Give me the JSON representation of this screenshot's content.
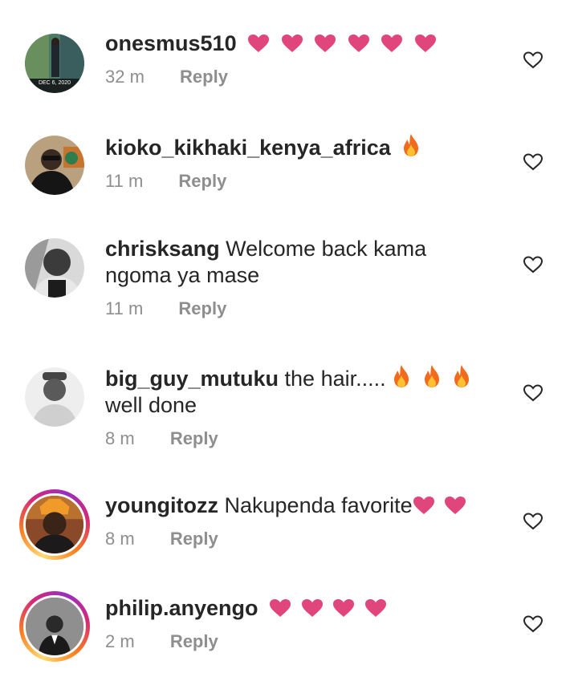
{
  "comments": [
    {
      "username": "onesmus510",
      "text": "",
      "time": "32 m",
      "reply": "Reply",
      "emoji": "heart",
      "emoji_count": 6,
      "avatar_caption": "DEC 6, 2020"
    },
    {
      "username": "kioko_kikhaki_kenya_africa",
      "text": "",
      "time": "11 m",
      "reply": "Reply",
      "emoji": "fire",
      "emoji_count": 1
    },
    {
      "username": "chrisksang",
      "text": "Welcome back kama ngoma ya mase",
      "time": "11 m",
      "reply": "Reply"
    },
    {
      "username": "big_guy_mutuku",
      "text_before": "the hair.....",
      "text_after": "well done",
      "time": "8 m",
      "reply": "Reply",
      "emoji": "fire",
      "emoji_count": 3
    },
    {
      "username": "youngitozz",
      "text": "Nakupenda favorite",
      "time": "8 m",
      "reply": "Reply",
      "emoji": "heart",
      "emoji_count": 2
    },
    {
      "username": "philip.anyengo",
      "text": "",
      "time": "2 m",
      "reply": "Reply",
      "emoji": "heart",
      "emoji_count": 4
    }
  ],
  "colors": {
    "heart": "#e0457b",
    "fire": "#f26a1b",
    "meta": "#8e8e8e",
    "text": "#262626"
  },
  "icons": {
    "like": "heart-outline-icon",
    "heart_emoji": "pink-heart-icon",
    "fire_emoji": "fire-icon"
  }
}
